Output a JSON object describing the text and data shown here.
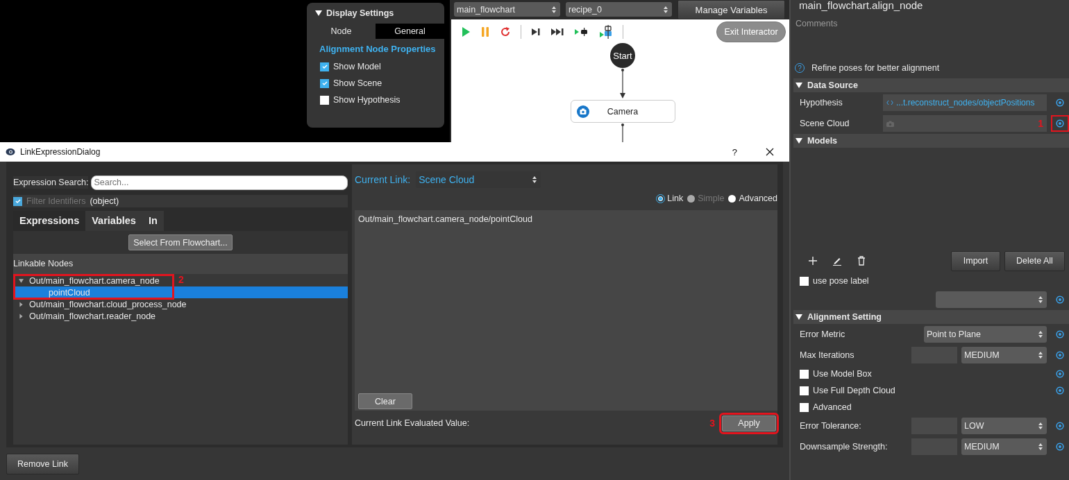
{
  "display_settings": {
    "title": "Display Settings",
    "expanded": true,
    "tabs": [
      {
        "label": "Node",
        "selected": false
      },
      {
        "label": "General",
        "selected": true
      }
    ],
    "heading": "Alignment Node Properties",
    "options": [
      {
        "label": "Show Model",
        "checked": true
      },
      {
        "label": "Show Scene",
        "checked": true
      },
      {
        "label": "Show Hypothesis",
        "checked": false
      }
    ]
  },
  "flow_toolbar": {
    "flowchart": "main_flowchart",
    "recipe": "recipe_0",
    "manage_button": "Manage Variables"
  },
  "flowchart": {
    "exit_button": "Exit Interactor",
    "nodes": [
      {
        "kind": "start",
        "label": "Start"
      },
      {
        "kind": "camera",
        "label": "Camera"
      }
    ]
  },
  "dialog": {
    "title": "LinkExpressionDialog",
    "help_button": "?",
    "search_label": "Expression Search:",
    "search_placeholder": "Search...",
    "filter": {
      "label": "Filter Identifiers",
      "checked": true,
      "disabled": true
    },
    "filter_value": "(object)",
    "tabs": [
      {
        "label": "Expressions",
        "selected": true
      },
      {
        "label": "Variables",
        "selected": false
      },
      {
        "label": "In",
        "selected": false
      }
    ],
    "select_button": "Select From Flowchart...",
    "tree_header": "Linkable Nodes",
    "tree_callout": "2",
    "tree": [
      {
        "label": "Out/main_flowchart.camera_node",
        "expanded": true,
        "selected": false,
        "children": [
          {
            "label": "pointCloud",
            "selected": true
          }
        ]
      },
      {
        "label": "Out/main_flowchart.cloud_process_node",
        "expanded": false,
        "selected": false
      },
      {
        "label": "Out/main_flowchart.reader_node",
        "expanded": false,
        "selected": false
      }
    ],
    "current_link_label": "Current Link:",
    "current_link": "Scene Cloud",
    "modes": [
      {
        "label": "Link",
        "selected": true,
        "disabled": false
      },
      {
        "label": "Simple",
        "selected": false,
        "disabled": true
      },
      {
        "label": "Advanced",
        "selected": false,
        "disabled": false
      }
    ],
    "expression": "Out/main_flowchart.camera_node/pointCloud",
    "clear_button": "Clear",
    "evaluated_label": "Current Link Evaluated Value:",
    "apply_button": "Apply",
    "apply_callout": "3",
    "remove_button": "Remove Link"
  },
  "properties": {
    "title": "main_flowchart.align_node",
    "comments_placeholder": "Comments",
    "description": "Refine poses for better alignment",
    "help_mark": "?",
    "sections": [
      {
        "title": "Data Source",
        "expanded": true,
        "rows": [
          {
            "kind": "link",
            "label": "Hypothesis",
            "value": "...t.reconstruct_nodes/objectPositions",
            "linked": true
          },
          {
            "kind": "link",
            "label": "Scene Cloud",
            "linked": true,
            "callout": "1"
          }
        ]
      },
      {
        "title": "Models",
        "expanded": true,
        "rows": [
          {
            "kind": "list"
          },
          {
            "kind": "toolbar",
            "buttons": [
              "Import",
              "Delete All"
            ]
          },
          {
            "kind": "checkbox",
            "label": "use pose label",
            "checked": false,
            "linked": false
          },
          {
            "kind": "combo",
            "linked": true
          }
        ]
      },
      {
        "title": "Alignment Setting",
        "expanded": true,
        "rows": [
          {
            "kind": "combo",
            "label": "Error Metric",
            "value": "Point to Plane",
            "linked": true
          },
          {
            "kind": "dual",
            "label": "Max Iterations",
            "value": "MEDIUM",
            "linked": true
          },
          {
            "kind": "checkbox",
            "label": "Use Model Box",
            "checked": false,
            "linked": true
          },
          {
            "kind": "checkbox",
            "label": "Use Full Depth Cloud",
            "checked": false,
            "linked": true
          },
          {
            "kind": "checkbox",
            "label": "Advanced",
            "checked": false,
            "linked": false
          },
          {
            "kind": "dual",
            "label": "Error Tolerance:",
            "value": "LOW",
            "linked": true
          },
          {
            "kind": "dual",
            "label": "Downsample Strength:",
            "value": "MEDIUM",
            "linked": true
          }
        ]
      }
    ]
  }
}
